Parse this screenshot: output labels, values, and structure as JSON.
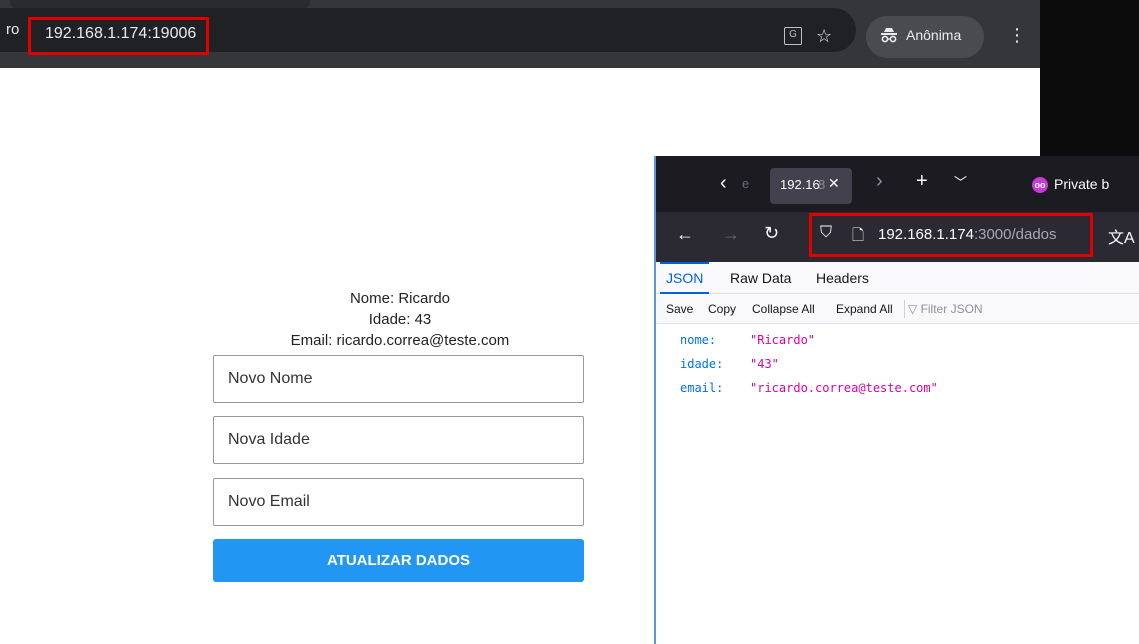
{
  "chrome": {
    "url_fragment": "ro",
    "url": "192.168.1.174:19006",
    "translate_icon": "translate-icon",
    "star_icon": "star-icon",
    "incognito_label": "Anônima",
    "menu_icon": "kebab-menu-icon"
  },
  "form": {
    "nome_line": "Nome: Ricardo",
    "idade_line": "Idade: 43",
    "email_line": "Email: ricardo.correa@teste.com",
    "nome_placeholder": "Novo Nome",
    "idade_placeholder": "Nova Idade",
    "email_placeholder": "Novo Email",
    "submit_label": "ATUALIZAR DADOS",
    "button_color": "#2196f3"
  },
  "firefox": {
    "tab_fragment": "e",
    "tab_title": "192.16",
    "tab_title_fade": "8",
    "private_label": "Private b",
    "url_host": "192.168.1.174",
    "url_path": ":3000/dados",
    "tabs": [
      {
        "label": "JSON"
      },
      {
        "label": "Raw Data"
      },
      {
        "label": "Headers"
      }
    ],
    "actions": [
      {
        "label": "Save"
      },
      {
        "label": "Copy"
      },
      {
        "label": "Collapse All"
      },
      {
        "label": "Expand All"
      }
    ],
    "filter_placeholder": "Filter JSON",
    "json": [
      {
        "key": "nome:",
        "value": "\"Ricardo\""
      },
      {
        "key": "idade:",
        "value": "\"43\""
      },
      {
        "key": "email:",
        "value": "\"ricardo.correa@teste.com\""
      }
    ]
  },
  "colors": {
    "highlight_box": "#e00000",
    "chrome_dark": "#35363a",
    "firefox_dark": "#2b2a33"
  }
}
